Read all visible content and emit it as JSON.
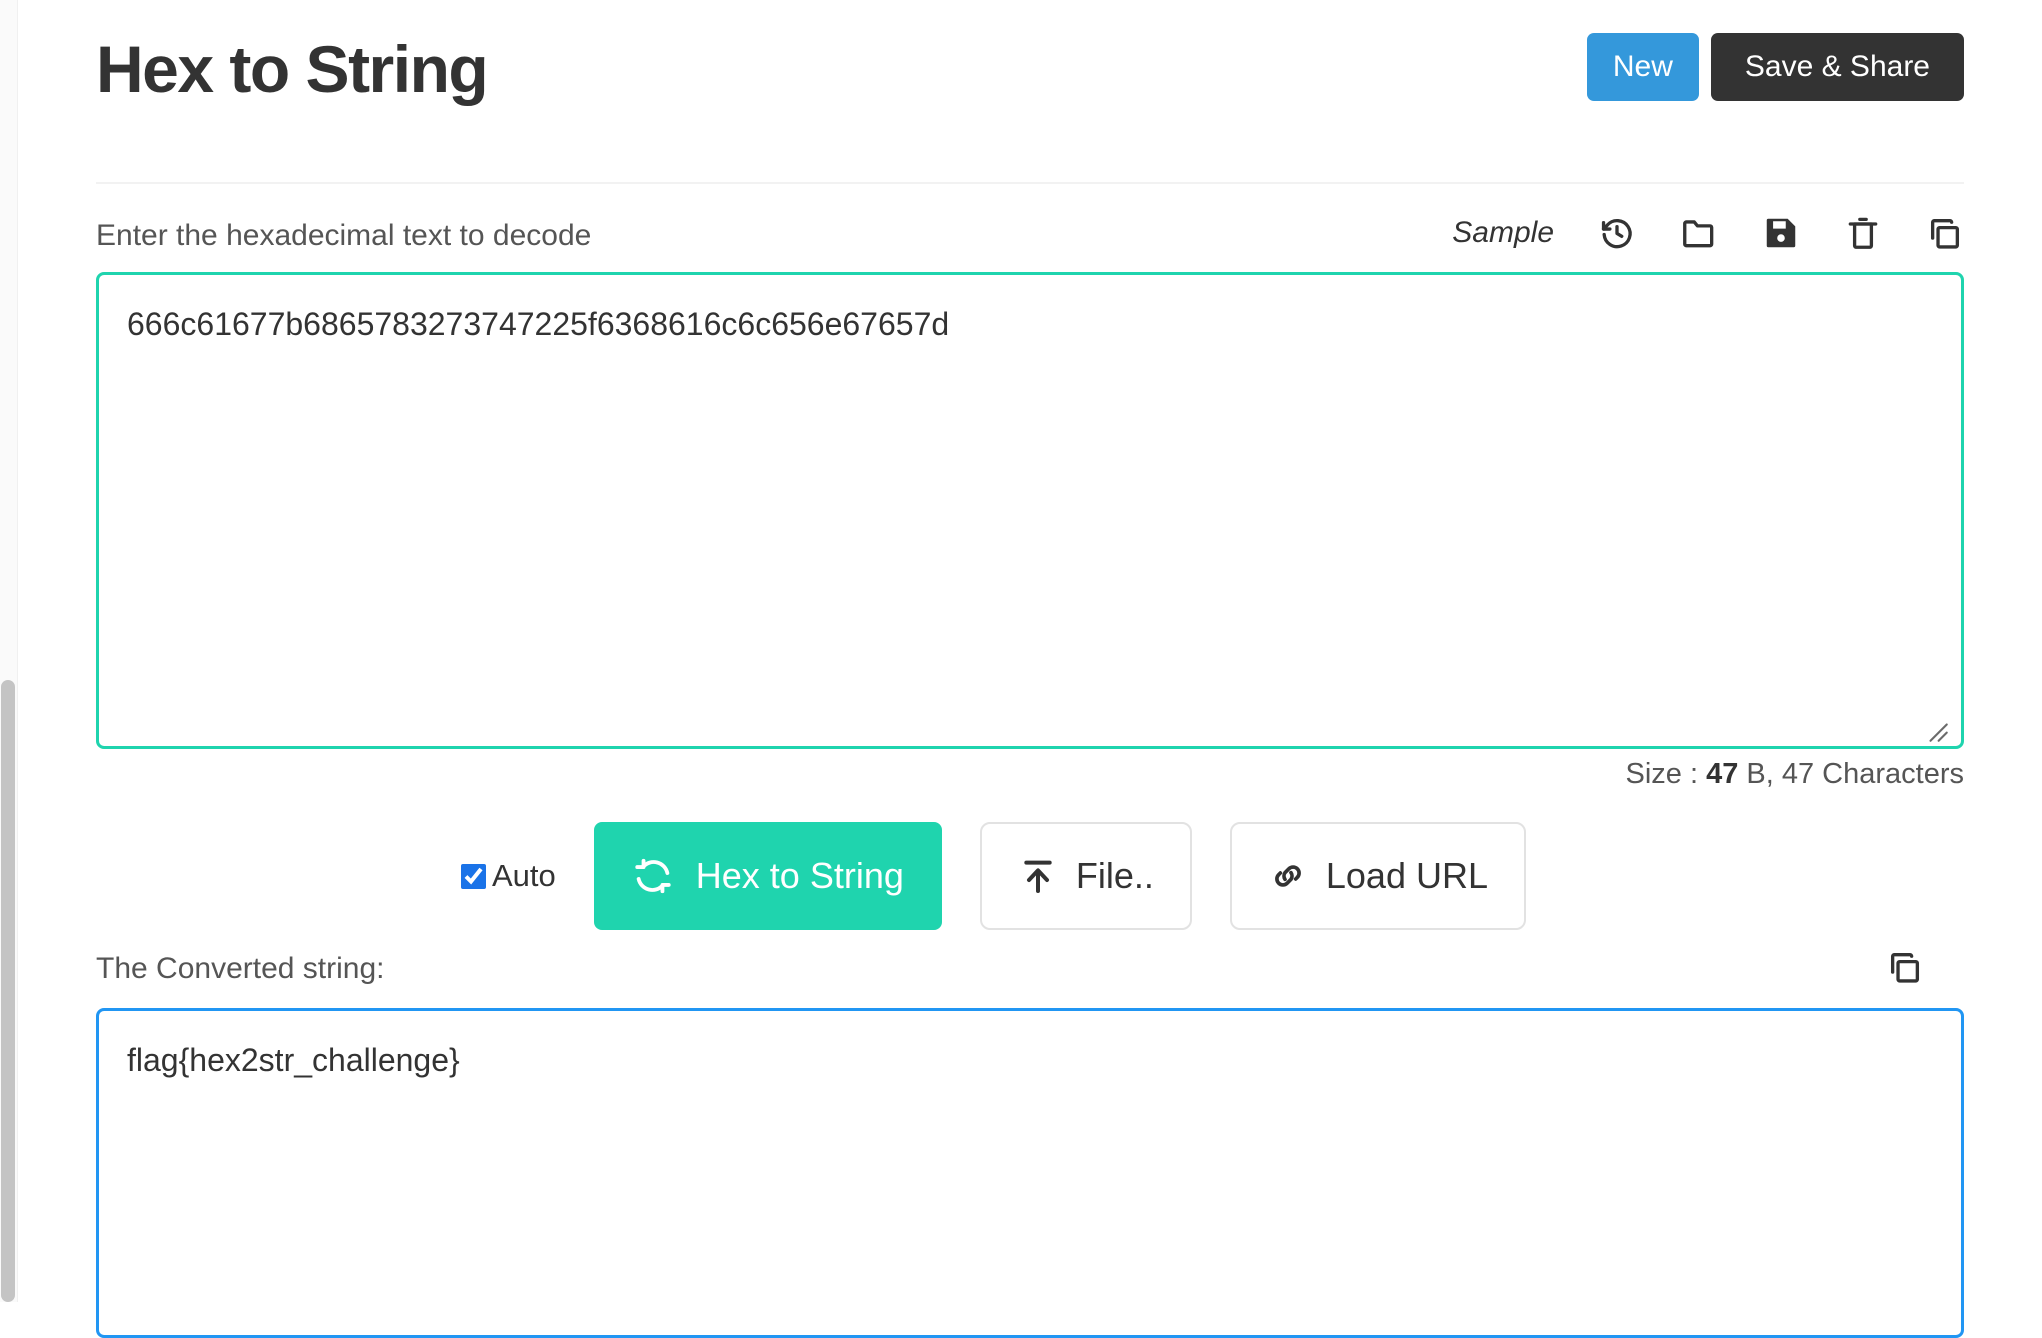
{
  "header": {
    "title": "Hex to String",
    "new_label": "New",
    "save_share_label": "Save & Share"
  },
  "input_section": {
    "label": "Enter the hexadecimal text to decode",
    "sample_label": "Sample",
    "icons": [
      "history-icon",
      "folder-open-icon",
      "save-floppy-icon",
      "trash-icon",
      "copy-icon"
    ],
    "value": "666c61677b6865783273747225f6368616c6c656e67657d",
    "placeholder": "",
    "size_prefix": "Size : ",
    "size_value": "47",
    "size_suffix": " B, 47 Characters"
  },
  "actions": {
    "auto_label": "Auto",
    "auto_checked": true,
    "convert_label": "Hex to String",
    "file_label": "File..",
    "load_url_label": "Load URL"
  },
  "output_section": {
    "label": "The Converted string:",
    "copy_icon": "copy-icon",
    "value": "flag{hex2str_challenge}",
    "placeholder": ""
  },
  "colors": {
    "accent_teal": "#1fd4ae",
    "accent_blue": "#2196f3",
    "new_button": "#3498db",
    "save_button": "#333333",
    "checkbox": "#1a73e8"
  }
}
